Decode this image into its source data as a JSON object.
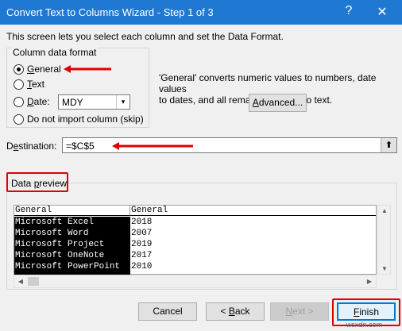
{
  "window": {
    "title": "Convert Text to Columns Wizard - Step 1 of 3",
    "help_glyph": "?",
    "close_glyph": "✕"
  },
  "intro": "This screen lets you select each column and set the Data Format.",
  "column_format": {
    "group_label": "Column data format",
    "general": {
      "mnemonic": "G",
      "rest": "eneral",
      "checked": true
    },
    "text": {
      "mnemonic": "T",
      "rest": "ext",
      "checked": false
    },
    "date": {
      "mnemonic": "D",
      "rest": "ate:",
      "checked": false
    },
    "skip": {
      "label": "Do not import column (skip)",
      "mnemonic": "i",
      "checked": false
    },
    "date_format": {
      "selected": "MDY",
      "arrow": "▾"
    }
  },
  "description": {
    "line1": "'General' converts numeric values to numbers, date values",
    "line2": "to dates, and all remaining values to text."
  },
  "advanced_button": {
    "mnemonic": "A",
    "rest": "dvanced..."
  },
  "destination": {
    "label_mnemonic": "e",
    "label_prefix": "D",
    "label_rest": "stination:",
    "value": "=$C$5",
    "collapse_glyph": "⬆"
  },
  "data_preview": {
    "label_prefix": "Data ",
    "label_mnemonic": "p",
    "label_rest": "review",
    "headers": [
      "General",
      "General"
    ],
    "rows": [
      [
        "Microsoft Excel",
        "2018"
      ],
      [
        "Microsoft Word",
        "2007"
      ],
      [
        "Microsoft Project",
        "2019"
      ],
      [
        "Microsoft OneNote",
        "2017"
      ],
      [
        "Microsoft PowerPoint",
        "2010"
      ]
    ]
  },
  "buttons": {
    "cancel": "Cancel",
    "back": {
      "prefix": "< ",
      "mnemonic": "B",
      "rest": "ack"
    },
    "next": {
      "mnemonic": "N",
      "rest": "ext >"
    },
    "finish": {
      "mnemonic": "F",
      "rest": "inish"
    }
  },
  "watermark": "wsxdn.com",
  "colors": {
    "title_bar": "#1f78d1",
    "annotation_red": "#e00000",
    "finish_focus": "#0078d7"
  }
}
